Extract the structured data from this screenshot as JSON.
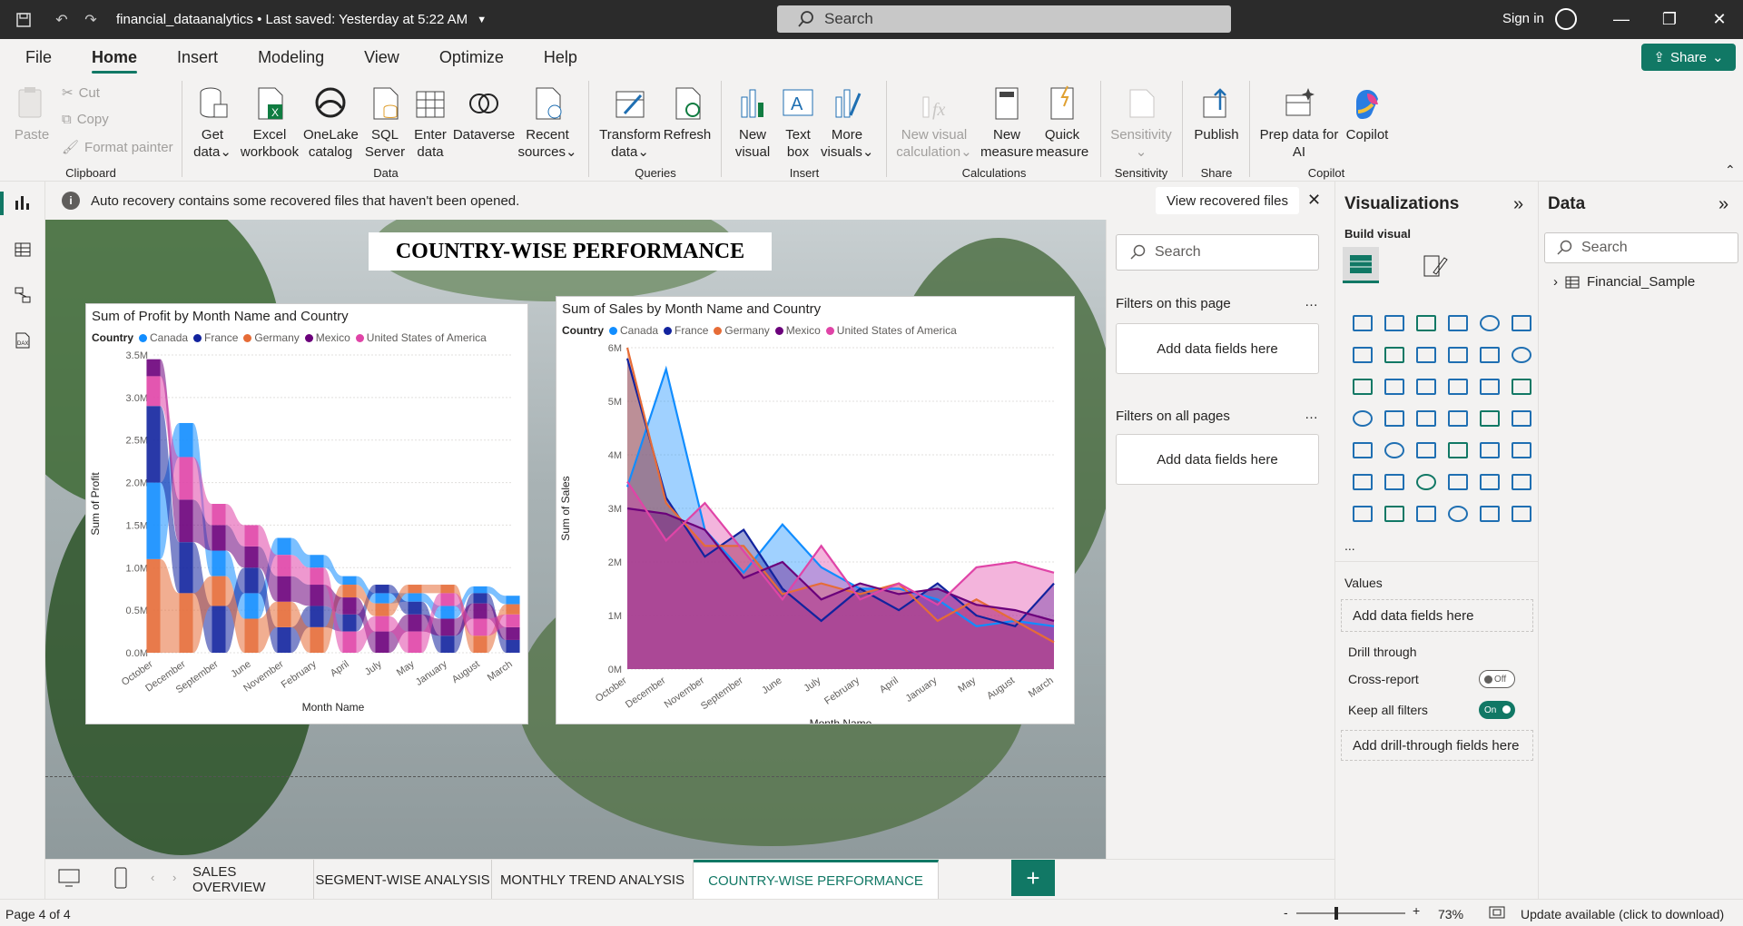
{
  "titlebar": {
    "filename": "financial_dataanalytics",
    "saved": "Last saved: Yesterday at 5:22 AM",
    "search": "Search",
    "signin": "Sign in"
  },
  "menu": [
    "File",
    "Home",
    "Insert",
    "Modeling",
    "View",
    "Optimize",
    "Help"
  ],
  "share_label": "Share",
  "ribbon": {
    "clipboard": {
      "paste": "Paste",
      "cut": "Cut",
      "copy": "Copy",
      "format_painter": "Format painter",
      "group": "Clipboard"
    },
    "data": {
      "get_data": "Get data",
      "excel": "Excel workbook",
      "onelake": "OneLake catalog",
      "sql": "SQL Server",
      "enter": "Enter data",
      "dataverse": "Dataverse",
      "recent": "Recent sources",
      "group": "Data"
    },
    "queries": {
      "transform": "Transform data",
      "refresh": "Refresh",
      "group": "Queries"
    },
    "insert": {
      "new_visual": "New visual",
      "text_box": "Text box",
      "more_visuals": "More visuals",
      "group": "Insert"
    },
    "calculations": {
      "new_visual_calc": "New visual calculation",
      "new_measure": "New measure",
      "quick_measure": "Quick measure",
      "group": "Calculations"
    },
    "sensitivity": {
      "label": "Sensitivity",
      "group": "Sensitivity"
    },
    "share": {
      "publish": "Publish",
      "group": "Share"
    },
    "copilot": {
      "prep": "Prep data for AI",
      "copilot": "Copilot",
      "group": "Copilot"
    }
  },
  "infobar": {
    "text": "Auto recovery contains some recovered files that haven't been opened.",
    "button": "View recovered files"
  },
  "page_title": "COUNTRY-WISE PERFORMANCE",
  "colors": {
    "Canada": "#118dff",
    "France": "#12239e",
    "Germany": "#e66c37",
    "Mexico": "#6b007b",
    "United States of America": "#e044a7"
  },
  "chart_data": [
    {
      "type": "area",
      "title": "Sum of Profit by Month Name and Country",
      "legend_title": "Country",
      "xlabel": "Month Name",
      "ylabel": "Sum of Profit",
      "categories": [
        "October",
        "December",
        "September",
        "June",
        "November",
        "February",
        "April",
        "July",
        "May",
        "January",
        "August",
        "March"
      ],
      "yticks": [
        "0.0M",
        "0.5M",
        "1.0M",
        "1.5M",
        "2.0M",
        "2.5M",
        "3.0M",
        "3.5M"
      ],
      "ylim": [
        0,
        3.5
      ],
      "series": [
        {
          "name": "Canada",
          "values": [
            0.9,
            0.4,
            0.3,
            0.3,
            0.2,
            0.15,
            0.1,
            0.12,
            0.1,
            0.15,
            0.08,
            0.1
          ]
        },
        {
          "name": "France",
          "values": [
            0.9,
            0.6,
            0.55,
            0.3,
            0.3,
            0.25,
            0.2,
            0.1,
            0.15,
            0.2,
            0.12,
            0.15
          ]
        },
        {
          "name": "Germany",
          "values": [
            1.1,
            0.7,
            0.35,
            0.4,
            0.3,
            0.3,
            0.15,
            0.15,
            0.1,
            0.1,
            0.2,
            0.12
          ]
        },
        {
          "name": "Mexico",
          "values": [
            0.2,
            0.5,
            0.3,
            0.25,
            0.3,
            0.25,
            0.2,
            0.25,
            0.2,
            0.2,
            0.18,
            0.15
          ]
        },
        {
          "name": "United States of America",
          "values": [
            0.35,
            0.5,
            0.25,
            0.25,
            0.25,
            0.2,
            0.25,
            0.18,
            0.25,
            0.15,
            0.2,
            0.15
          ]
        }
      ]
    },
    {
      "type": "area",
      "title": "Sum of Sales by Month Name and Country",
      "legend_title": "Country",
      "xlabel": "Month Name",
      "ylabel": "Sum of Sales",
      "categories": [
        "October",
        "December",
        "November",
        "September",
        "June",
        "July",
        "February",
        "April",
        "January",
        "May",
        "August",
        "March"
      ],
      "yticks": [
        "0M",
        "1M",
        "2M",
        "3M",
        "4M",
        "5M",
        "6M"
      ],
      "ylim": [
        0,
        6
      ],
      "series": [
        {
          "name": "Canada",
          "values": [
            3.4,
            5.6,
            2.6,
            1.8,
            2.7,
            1.9,
            1.5,
            1.5,
            1.3,
            0.8,
            0.9,
            0.8
          ]
        },
        {
          "name": "France",
          "values": [
            5.8,
            3.2,
            2.1,
            2.6,
            1.5,
            0.9,
            1.5,
            1.1,
            1.6,
            1.0,
            0.8,
            1.6
          ]
        },
        {
          "name": "Germany",
          "values": [
            6.0,
            3.1,
            2.3,
            2.3,
            1.4,
            1.6,
            1.4,
            1.6,
            0.9,
            1.3,
            0.9,
            0.5
          ]
        },
        {
          "name": "Mexico",
          "values": [
            3.0,
            2.9,
            2.6,
            1.7,
            2.0,
            1.3,
            1.6,
            1.4,
            1.5,
            1.2,
            1.1,
            0.9
          ]
        },
        {
          "name": "United States of America",
          "values": [
            3.5,
            2.4,
            3.1,
            2.2,
            1.3,
            2.3,
            1.3,
            1.6,
            1.2,
            1.9,
            2.0,
            1.8
          ]
        }
      ]
    }
  ],
  "filters": {
    "search": "Search",
    "this_page": "Filters on this page",
    "all_pages": "Filters on all pages",
    "add": "Add data fields here"
  },
  "viz": {
    "title": "Visualizations",
    "build": "Build visual",
    "values": "Values",
    "add": "Add data fields here",
    "drill": "Drill through",
    "cross": "Cross-report",
    "cross_state": "Off",
    "keep": "Keep all filters",
    "keep_state": "On",
    "add_drill": "Add drill-through fields here",
    "more": "..."
  },
  "data_pane": {
    "title": "Data",
    "search": "Search",
    "table": "Financial_Sample"
  },
  "tabs": [
    "SALES OVERVIEW",
    "SEGMENT-WISE ANALYSIS",
    "MONTHLY TREND ANALYSIS",
    "COUNTRY-WISE PERFORMANCE"
  ],
  "status": {
    "page": "Page 4 of 4",
    "zoom": "73%",
    "update": "Update available (click to download)"
  }
}
